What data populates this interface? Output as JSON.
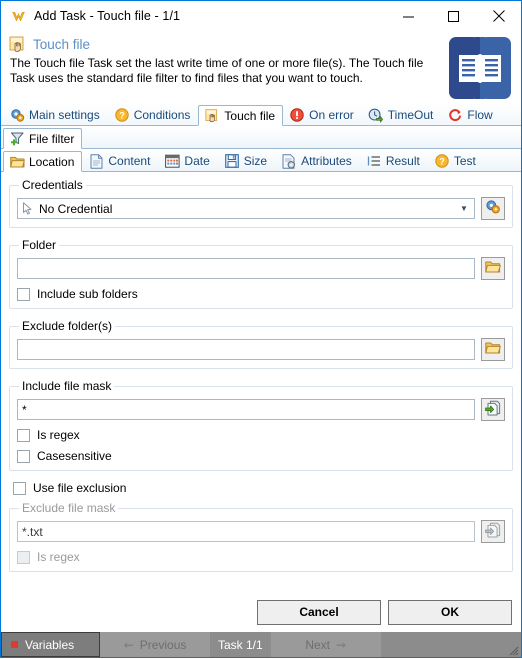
{
  "window": {
    "title": "Add Task - Touch file - 1/1",
    "app_icon": "visualcron-logo-icon",
    "minimize_label": "—",
    "maximize_label": "☐",
    "close_label": "✕"
  },
  "header": {
    "icon": "touch-file-icon",
    "title": "Touch file",
    "description": "The Touch file Task set the last write time of one or more file(s). The Touch file Task uses the standard file filter to find files that you want to touch.",
    "side_icon": "book-icon"
  },
  "tabs_main": [
    {
      "label": "Main settings",
      "icon": "gears-icon",
      "active": false
    },
    {
      "label": "Conditions",
      "icon": "question-orange-icon",
      "active": false
    },
    {
      "label": "Touch file",
      "icon": "touch-file-icon",
      "active": true
    },
    {
      "label": "On error",
      "icon": "error-red-icon",
      "active": false
    },
    {
      "label": "TimeOut",
      "icon": "timeout-clock-icon",
      "active": false
    },
    {
      "label": "Flow",
      "icon": "flow-arrow-icon",
      "active": false
    }
  ],
  "tabs_sub": [
    {
      "label": "File filter",
      "icon": "funnel-add-icon",
      "active": true
    }
  ],
  "tabs_filter": [
    {
      "label": "Location",
      "icon": "folder-icon",
      "active": true
    },
    {
      "label": "Content",
      "icon": "page-icon",
      "active": false
    },
    {
      "label": "Date",
      "icon": "calendar-icon",
      "active": false
    },
    {
      "label": "Size",
      "icon": "floppy-icon",
      "active": false
    },
    {
      "label": "Attributes",
      "icon": "attributes-icon",
      "active": false
    },
    {
      "label": "Result",
      "icon": "list-icon",
      "active": false
    },
    {
      "label": "Test",
      "icon": "question-orange-icon",
      "active": false
    }
  ],
  "form": {
    "credentials": {
      "legend": "Credentials",
      "value": "No Credential",
      "icon": "cursor-arrow-icon",
      "dropdown_arrow": "▼",
      "settings_button_icon": "gears-blue-icon"
    },
    "folder": {
      "legend": "Folder",
      "value": "",
      "placeholder": "",
      "browse_button_icon": "folder-open-icon",
      "include_sub_folders_label": "Include sub folders",
      "include_sub_folders_checked": false
    },
    "exclude_folders": {
      "legend": "Exclude folder(s)",
      "value": "",
      "placeholder": "",
      "browse_button_icon": "folder-open-icon"
    },
    "include_file_mask": {
      "legend": "Include file mask",
      "value": "*",
      "placeholder": "",
      "insert_button_icon": "insert-green-icon",
      "is_regex_label": "Is regex",
      "is_regex_checked": false,
      "casesensitive_label": "Casesensitive",
      "casesensitive_checked": false
    },
    "use_file_exclusion": {
      "label": "Use file exclusion",
      "checked": false
    },
    "exclude_file_mask": {
      "legend": "Exclude file mask",
      "value": "*.txt",
      "placeholder": "",
      "insert_button_icon": "insert-grey-icon",
      "is_regex_label": "Is regex",
      "is_regex_checked": false,
      "disabled": true
    }
  },
  "footer": {
    "cancel_label": "Cancel",
    "ok_label": "OK"
  },
  "statusbar": {
    "variables_label": "Variables",
    "previous_label": "Previous",
    "task_label": "Task 1/1",
    "next_label": "Next",
    "prev_arrow": "⇜",
    "next_arrow": "⇝"
  },
  "colors": {
    "window_border": "#0078d7",
    "header_title": "#5a8fc8",
    "tab_text": "#1b4a7a",
    "statusbar_bg": "#8c8c8c",
    "variables_dot": "#e03a2f",
    "book_icon_left": "#2f4a8c",
    "book_icon_right": "#3a63a8"
  }
}
